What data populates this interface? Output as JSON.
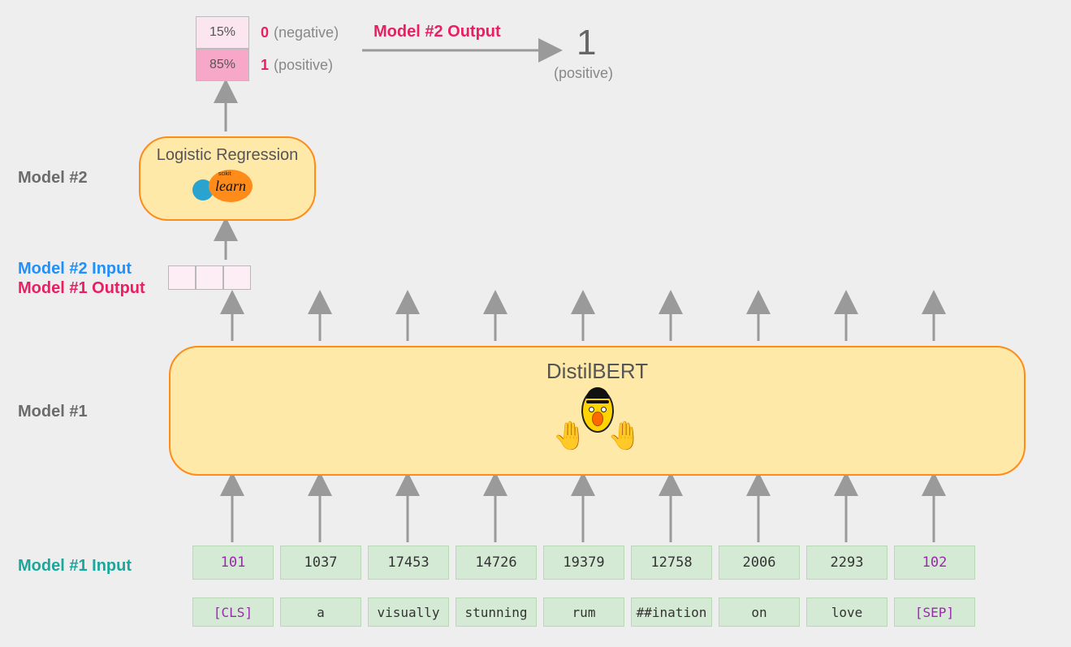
{
  "labels": {
    "model2_output": "Model #2 Output",
    "model2": "Model #2",
    "model2_input": "Model #2 Input",
    "model1_output": "Model #1 Output",
    "model1": "Model #1",
    "model1_input": "Model #1 Input"
  },
  "logreg": {
    "title": "Logistic Regression",
    "lib_small": "scikit",
    "lib": "learn"
  },
  "distilbert": {
    "title": "DistilBERT"
  },
  "final": {
    "value": "1",
    "desc": "(positive)"
  },
  "probs": [
    {
      "pct": "15%",
      "cls": "0",
      "desc": "(negative)",
      "style": "low"
    },
    {
      "pct": "85%",
      "cls": "1",
      "desc": "(positive)",
      "style": "high"
    }
  ],
  "tokens": {
    "ids": [
      "101",
      "1037",
      "17453",
      "14726",
      "19379",
      "12758",
      "2006",
      "2293",
      "102"
    ],
    "words": [
      "[CLS]",
      "a",
      "visually",
      "stunning",
      "rum",
      "##ination",
      "on",
      "love",
      "[SEP]"
    ],
    "special_idx": [
      0,
      8
    ]
  },
  "arrow_xs": [
    286,
    394,
    502,
    610,
    718,
    826,
    934,
    1042,
    1150
  ]
}
